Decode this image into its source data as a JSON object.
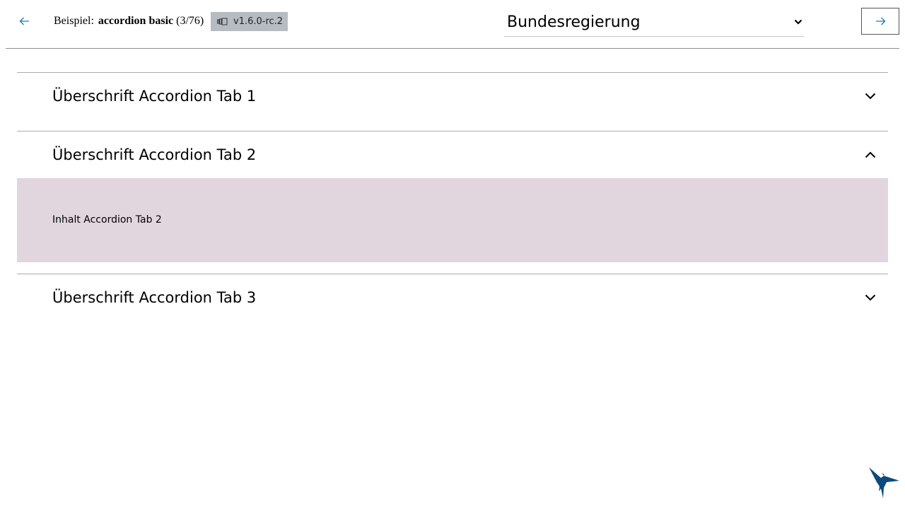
{
  "header": {
    "prev_icon": "arrow-left-icon",
    "example_prefix": "Beispiel:",
    "example_name": "accordion basic",
    "example_counter": "(3/76)",
    "version_icon": "component-icon",
    "version": "v1.6.0-rc.2",
    "theme_selected": "Bundesregierung",
    "theme_chevron_icon": "chevron-down-icon",
    "next_icon": "arrow-right-icon"
  },
  "accordion": {
    "items": [
      {
        "title": "Überschrift Accordion Tab 1",
        "expanded": false,
        "icon": "chevron-down-icon"
      },
      {
        "title": "Überschrift Accordion Tab 2",
        "expanded": true,
        "icon": "chevron-up-icon",
        "content": "Inhalt Accordion Tab 2"
      },
      {
        "title": "Überschrift Accordion Tab 3",
        "expanded": false,
        "icon": "chevron-down-icon"
      }
    ]
  },
  "logo_icon": "hummingbird-logo-icon",
  "colors": {
    "accent_arrow": "#1a7ab5",
    "badge_bg": "#b6bcc1",
    "panel_bg": "#e1d6de",
    "logo": "#0b4a7a"
  }
}
